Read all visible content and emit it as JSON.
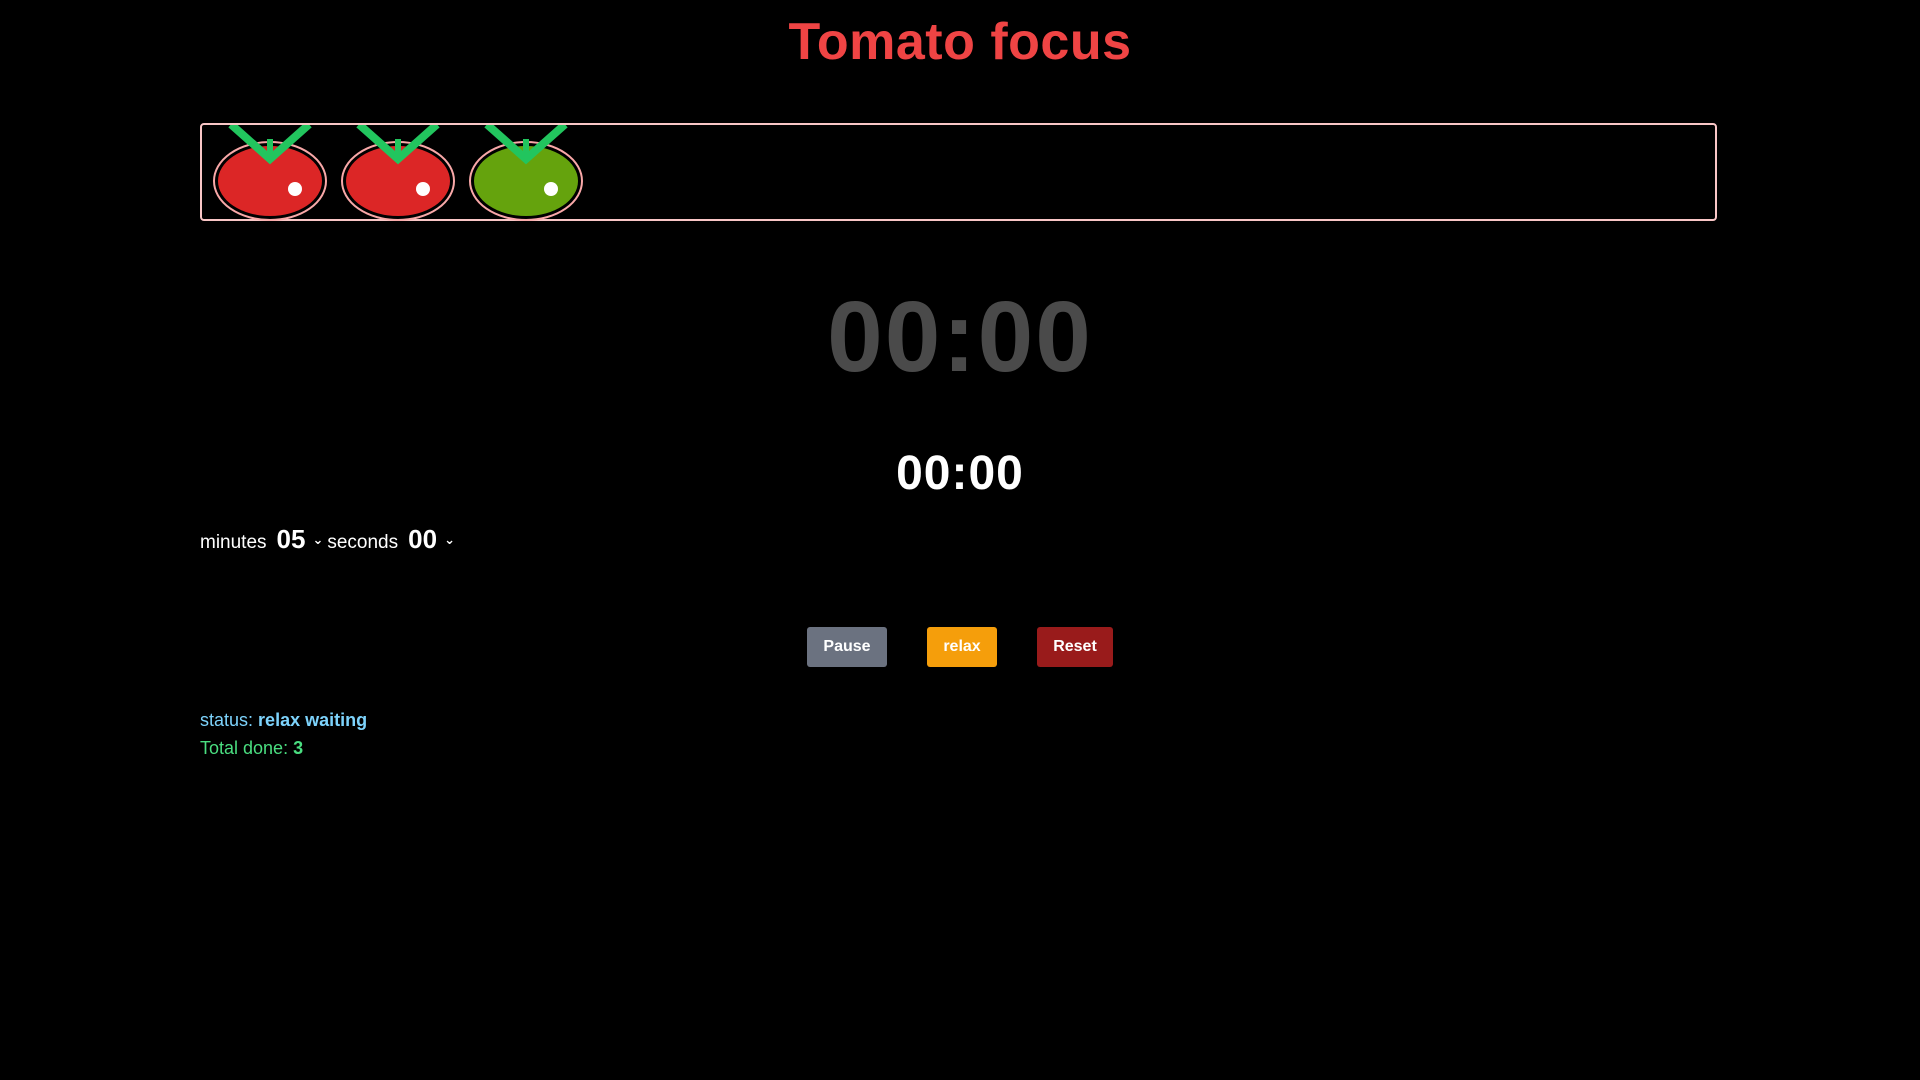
{
  "app": {
    "title": "Tomato focus"
  },
  "tomatoes": [
    {
      "state": "done",
      "color": "#dc2626"
    },
    {
      "state": "done",
      "color": "#dc2626"
    },
    {
      "state": "relax",
      "color": "#65a30d"
    }
  ],
  "colors": {
    "title": "#ef4444",
    "bar_border": "#f9c6c6",
    "leaf": "#22c55e",
    "pause": "#6b7280",
    "relax": "#f59e0b",
    "reset": "#991b1b",
    "status": "#7dd3fc",
    "total": "#4ade80"
  },
  "timer": {
    "main": "00:00",
    "secondary": "00:00"
  },
  "picker": {
    "minutes_label": "minutes",
    "minutes_value": "05",
    "seconds_label": "seconds",
    "seconds_value": "00"
  },
  "buttons": {
    "pause": "Pause",
    "relax": "relax",
    "reset": "Reset"
  },
  "status": {
    "label": "status:",
    "value": "relax waiting"
  },
  "total": {
    "label": "Total done:",
    "value": "3"
  }
}
